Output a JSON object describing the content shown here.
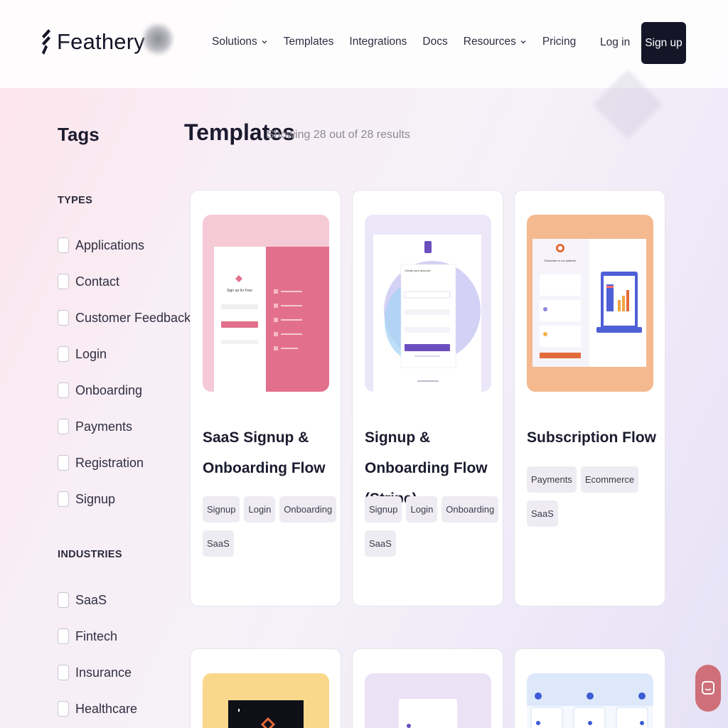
{
  "header": {
    "logo_text": "Feathery",
    "nav": [
      {
        "label": "Solutions",
        "has_dropdown": true
      },
      {
        "label": "Templates",
        "has_dropdown": false
      },
      {
        "label": "Integrations",
        "has_dropdown": false
      },
      {
        "label": "Docs",
        "has_dropdown": false
      },
      {
        "label": "Resources",
        "has_dropdown": true
      },
      {
        "label": "Pricing",
        "has_dropdown": false
      }
    ],
    "login_label": "Log in",
    "signup_label": "Sign up"
  },
  "sidebar": {
    "title": "Tags",
    "types_heading": "TYPES",
    "types": [
      "Applications",
      "Contact",
      "Customer Feedback",
      "Login",
      "Onboarding",
      "Payments",
      "Registration",
      "Signup"
    ],
    "industries_heading": "INDUSTRIES",
    "industries": [
      "SaaS",
      "Fintech",
      "Insurance",
      "Healthcare"
    ]
  },
  "main": {
    "title": "Templates",
    "result_count": "Showing 28 out of 28 results",
    "cards": [
      {
        "title": "SaaS Signup & Onboarding Flow",
        "tags": [
          "Signup",
          "Login",
          "Onboarding",
          "SaaS"
        ],
        "thumb_color": "#f6c9d6"
      },
      {
        "title": "Signup & Onboarding Flow (Stripe)",
        "tags": [
          "Signup",
          "Login",
          "Onboarding",
          "SaaS"
        ],
        "thumb_color": "#ebe6f8"
      },
      {
        "title": "Subscription Flow",
        "tags": [
          "Payments",
          "Ecommerce",
          "SaaS"
        ],
        "thumb_color": "#f4b98f"
      }
    ]
  },
  "thumb_text": {
    "card1_heading": "Sign up for Free",
    "card2_heading": "Create your account",
    "card3_heading": "Subscribe to our platform"
  },
  "colors": {
    "brand_dark": "#151528",
    "chat_button": "#cf6f77",
    "pink_accent": "#e2708c",
    "purple_accent": "#6b4fbf",
    "orange_accent": "#e26a3b"
  }
}
